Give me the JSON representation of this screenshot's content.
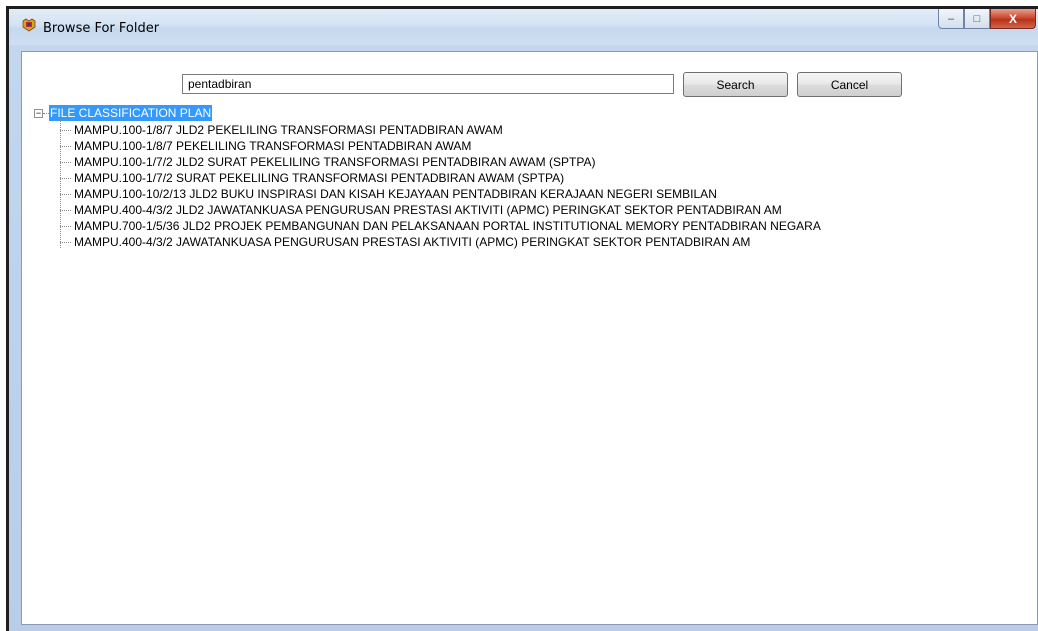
{
  "window": {
    "title": "Browse For Folder",
    "controls": {
      "minimize": "–",
      "maximize": "□",
      "close": "X"
    }
  },
  "search": {
    "value": "pentadbiran",
    "search_label": "Search",
    "cancel_label": "Cancel"
  },
  "tree": {
    "expander": "−",
    "root_label": "FILE CLASSIFICATION PLAN",
    "items": [
      "MAMPU.100-1/8/7 JLD2 PEKELILING TRANSFORMASI PENTADBIRAN AWAM",
      "MAMPU.100-1/8/7 PEKELILING TRANSFORMASI PENTADBIRAN AWAM",
      "MAMPU.100-1/7/2 JLD2 SURAT PEKELILING TRANSFORMASI PENTADBIRAN AWAM (SPTPA)",
      "MAMPU.100-1/7/2 SURAT PEKELILING TRANSFORMASI PENTADBIRAN AWAM (SPTPA)",
      "MAMPU.100-10/2/13 JLD2 BUKU INSPIRASI DAN KISAH KEJAYAAN PENTADBIRAN KERAJAAN NEGERI SEMBILAN",
      "MAMPU.400-4/3/2 JLD2 JAWATANKUASA PENGURUSAN PRESTASI AKTIVITI (APMC) PERINGKAT SEKTOR PENTADBIRAN AM",
      "MAMPU.700-1/5/36 JLD2 PROJEK PEMBANGUNAN DAN PELAKSANAAN PORTAL INSTITUTIONAL MEMORY PENTADBIRAN NEGARA",
      "MAMPU.400-4/3/2 JAWATANKUASA PENGURUSAN PRESTASI AKTIVITI (APMC) PERINGKAT SEKTOR PENTADBIRAN AM"
    ]
  },
  "colors": {
    "selection": "#3399ff",
    "frame": "#c3d6ee"
  }
}
